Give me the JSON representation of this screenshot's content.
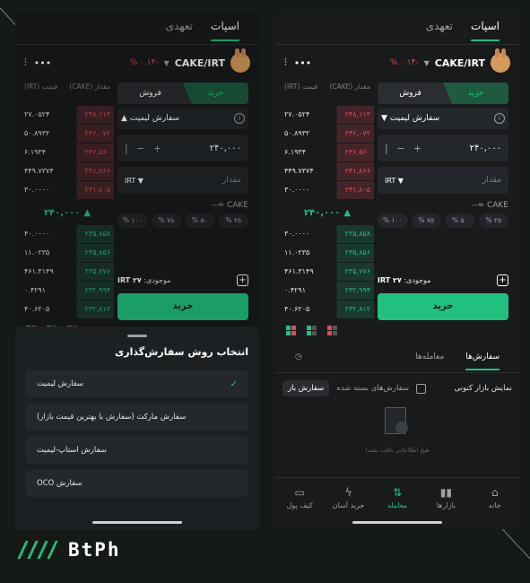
{
  "tabs": {
    "spot": "اسپات",
    "futures": "تعهدی"
  },
  "pair": {
    "name": "CAKE/IRT",
    "change": "-٠.١۴ %"
  },
  "book": {
    "price_header": "قیمت\n(IRT)",
    "amount_header": "مقدار\n(CAKE)",
    "asks": [
      {
        "p": "۲۴۸,۱۱۳",
        "q": "۲۷.۰۵۲۴"
      },
      {
        "p": "۲۴۶,۰۷۲",
        "q": "۵۰.۸۹۳۲"
      },
      {
        "p": "۲۴۶,۵۶۰",
        "q": "۶.۱۹۳۴"
      },
      {
        "p": "۲۴۱,۸۶۶",
        "q": "۴۴۹.۷۳۷۴"
      },
      {
        "p": "۲۴۱,۸۰۵",
        "q": "۳۰.۰۰۰۰"
      }
    ],
    "mid": "۲۴۰,۰۰۰",
    "bids": [
      {
        "p": "۲۳۵,۸۵۸",
        "q": "۳۰.۰۰۰۰"
      },
      {
        "p": "۲۳۵,۸۵۶",
        "q": "۱۱.۰۲۳۵"
      },
      {
        "p": "۲۳۵,۷۷۶",
        "q": "۴۶۱.۳۱۴۹"
      },
      {
        "p": "۲۳۲,۹۹۴",
        "q": "۰.۴۲۹۱"
      },
      {
        "p": "۲۳۲,۸۱۲",
        "q": "۴۰.۶۲۰۵"
      }
    ]
  },
  "form": {
    "buy": "خرید",
    "sell": "فروش",
    "order_type": "سفارش لیمیت",
    "price": "۲۴۰,۰۰۰",
    "amount_placeholder": "مقدار",
    "currency": "IRT",
    "cake": "CAKE",
    "pcts": [
      "۲۵ %",
      "۵۰ %",
      "۷۵ %",
      "۱۰۰ %"
    ],
    "balance_label": "موجودی:",
    "balance": "۲۷ IRT",
    "submit": "خرید"
  },
  "sheet": {
    "title": "انتخاب روش سفارش‌گذاری",
    "options": [
      "سفارش لیمیت",
      "سفارش مارکت (سفارش با بهترین قیمت بازار)",
      "سفارش استاپ-لیمیت",
      "سفارش OCO"
    ]
  },
  "orders": {
    "tab_orders": "سفارش‌ها",
    "tab_trades": "معامله‌ها",
    "open": "سفارش باز",
    "closed": "سفارش‌های بسته شده",
    "show_current": "نمایش بازار کنونی",
    "empty": "هیچ اطلاعاتی یافت نشد!"
  },
  "nav": {
    "home": "خانه",
    "markets": "بازارها",
    "trade": "معامله",
    "easy": "خرید آسان",
    "wallet": "کیف پول"
  },
  "brand": "BtPh"
}
